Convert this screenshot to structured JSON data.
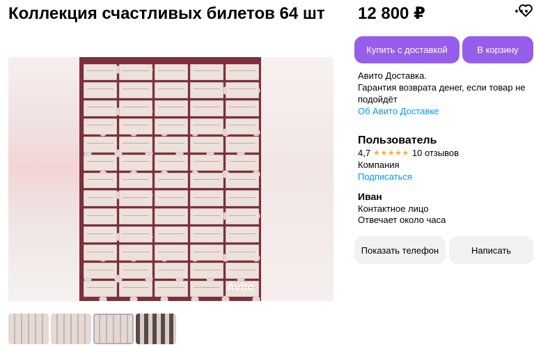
{
  "listing": {
    "title": "Коллекция счастливых билетов 64 шт",
    "price": "12 800 ₽",
    "watermark": "Avito"
  },
  "actions": {
    "buy_label": "Купить с доставкой",
    "cart_label": "В корзину",
    "more_icon": "more-dots-icon",
    "favorite_icon": "heart-icon"
  },
  "delivery": {
    "line1": "Авито Доставка.",
    "line2": "Гарантия возврата денег, если товар не подойдёт",
    "link": "Об Авито Доставке"
  },
  "seller": {
    "name": "Пользователь",
    "rating": "4,7",
    "stars": "★★★★★",
    "reviews": "10 отзывов",
    "type": "Компания",
    "subscribe": "Подписаться"
  },
  "contact": {
    "name": "Иван",
    "role": "Контактное лицо",
    "response": "Отвечает около часа",
    "phone_label": "Показать телефон",
    "write_label": "Написать"
  },
  "colors": {
    "accent": "#965eeb",
    "link": "#0099f7",
    "star": "#ffb021",
    "secondary_button": "#f2f1f0"
  }
}
